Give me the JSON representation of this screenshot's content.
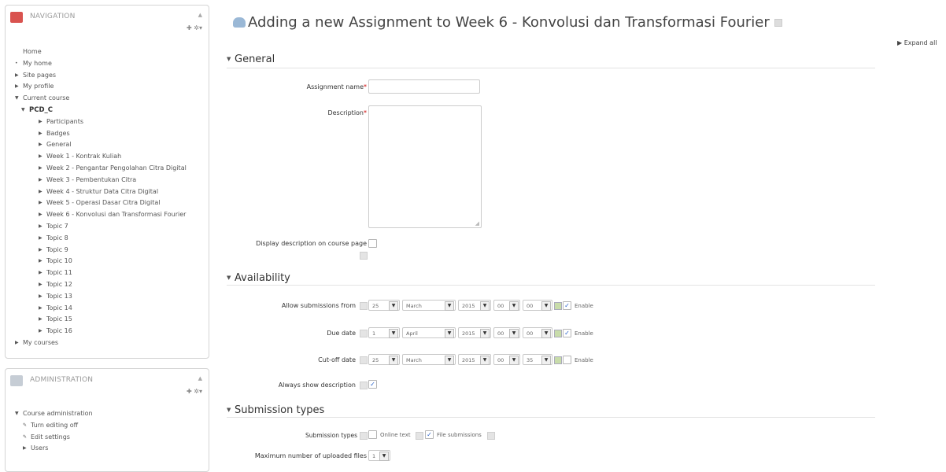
{
  "navigation": {
    "title": "NAVIGATION",
    "hide_icon": "▲",
    "controls": "✚ ✲▾",
    "items": [
      {
        "label": "Home",
        "mark": ""
      },
      {
        "label": "My home",
        "mark": "•"
      },
      {
        "label": "Site pages",
        "mark": "▶"
      },
      {
        "label": "My profile",
        "mark": "▶"
      },
      {
        "label": "Current course",
        "mark": "▼"
      },
      {
        "label": "PCD_C",
        "mark": "▼"
      },
      {
        "label": "Participants",
        "mark": "▶"
      },
      {
        "label": "Badges",
        "mark": "▶"
      },
      {
        "label": "General",
        "mark": "▶"
      },
      {
        "label": "Week 1 - Kontrak Kuliah",
        "mark": "▶"
      },
      {
        "label": "Week 2 - Pengantar Pengolahan Citra Digital",
        "mark": "▶"
      },
      {
        "label": "Week 3 - Pembentukan Citra",
        "mark": "▶"
      },
      {
        "label": "Week 4 - Struktur Data Citra Digital",
        "mark": "▶"
      },
      {
        "label": "Week 5 - Operasi Dasar Citra Digital",
        "mark": "▶"
      },
      {
        "label": "Week 6 - Konvolusi dan Transformasi Fourier",
        "mark": "▶"
      },
      {
        "label": "Topic 7",
        "mark": "▶"
      },
      {
        "label": "Topic 8",
        "mark": "▶"
      },
      {
        "label": "Topic 9",
        "mark": "▶"
      },
      {
        "label": "Topic 10",
        "mark": "▶"
      },
      {
        "label": "Topic 11",
        "mark": "▶"
      },
      {
        "label": "Topic 12",
        "mark": "▶"
      },
      {
        "label": "Topic 13",
        "mark": "▶"
      },
      {
        "label": "Topic 14",
        "mark": "▶"
      },
      {
        "label": "Topic 15",
        "mark": "▶"
      },
      {
        "label": "Topic 16",
        "mark": "▶"
      },
      {
        "label": "My courses",
        "mark": "▶"
      }
    ]
  },
  "administration": {
    "title": "ADMINISTRATION",
    "hide_icon": "▲",
    "controls": "✚ ✲▾",
    "items": [
      {
        "label": "Course administration",
        "mark": "▼"
      },
      {
        "label": "Turn editing off",
        "mark": "✎"
      },
      {
        "label": "Edit settings",
        "mark": "✎"
      },
      {
        "label": "Users",
        "mark": "▶"
      }
    ]
  },
  "page": {
    "title": "Adding a new Assignment to Week 6 - Konvolusi dan Transformasi Fourier",
    "expand_all": "Expand all"
  },
  "sections": {
    "general": "General",
    "availability": "Availability",
    "submission_types": "Submission types"
  },
  "general": {
    "assignment_name_label": "Assignment name",
    "assignment_name_value": "",
    "description_label": "Description",
    "description_value": "",
    "display_description_label": "Display description on course page",
    "display_description_checked": false
  },
  "availability": {
    "allow_from": {
      "label": "Allow submissions from",
      "day": "25",
      "month": "March",
      "year": "2015",
      "hour": "00",
      "minute": "00",
      "enable": "Enable",
      "enabled": true
    },
    "due_date": {
      "label": "Due date",
      "day": "1",
      "month": "April",
      "year": "2015",
      "hour": "00",
      "minute": "00",
      "enable": "Enable",
      "enabled": true
    },
    "cutoff_date": {
      "label": "Cut-off date",
      "day": "25",
      "month": "March",
      "year": "2015",
      "hour": "00",
      "minute": "35",
      "enable": "Enable",
      "enabled": false
    },
    "always_show": {
      "label": "Always show description",
      "checked": true
    }
  },
  "submission": {
    "types_label": "Submission types",
    "online_text": "Online text",
    "online_text_checked": false,
    "file_submissions": "File submissions",
    "file_submissions_checked": true,
    "max_files_label": "Maximum number of uploaded files",
    "max_files_value": "1"
  },
  "colors": {
    "nav_icon": "#d9534f",
    "admin_icon": "#c6cdd5",
    "required": "#cc0000",
    "check": "#2a62c9"
  }
}
